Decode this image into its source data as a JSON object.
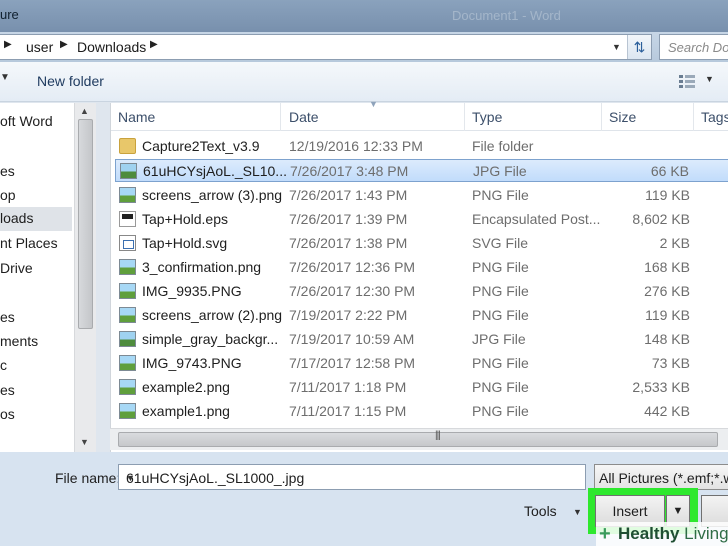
{
  "window": {
    "title_fragment": "ure",
    "document_title": "Document1 - Word"
  },
  "address": {
    "crumbs": [
      "user",
      "Downloads"
    ]
  },
  "search": {
    "placeholder": "Search Do"
  },
  "toolbar": {
    "new_folder_label": "New folder"
  },
  "nav": {
    "items": [
      "oft Word",
      "es",
      "op",
      "loads",
      "nt Places",
      "Drive",
      "es",
      "ments",
      "c",
      "es",
      "os"
    ],
    "selected_index": 3
  },
  "columns": {
    "name": "Name",
    "date": "Date",
    "type": "Type",
    "size": "Size",
    "tags": "Tags"
  },
  "files": [
    {
      "name": "Capture2Text_v3.9",
      "date": "12/19/2016 12:33 PM",
      "type": "File folder",
      "size": "",
      "icon": "folder-icon"
    },
    {
      "name": "61uHCYsjAoL._SL10...",
      "date": "7/26/2017 3:48 PM",
      "type": "JPG File",
      "size": "66 KB",
      "icon": "jpg-file-icon"
    },
    {
      "name": "screens_arrow (3).png",
      "date": "7/26/2017 1:43 PM",
      "type": "PNG File",
      "size": "119 KB",
      "icon": "png-file-icon"
    },
    {
      "name": "Tap+Hold.eps",
      "date": "7/26/2017 1:39 PM",
      "type": "Encapsulated Post...",
      "size": "8,602 KB",
      "icon": "eps-file-icon"
    },
    {
      "name": "Tap+Hold.svg",
      "date": "7/26/2017 1:38 PM",
      "type": "SVG File",
      "size": "2 KB",
      "icon": "svg-file-icon"
    },
    {
      "name": "3_confirmation.png",
      "date": "7/26/2017 12:36 PM",
      "type": "PNG File",
      "size": "168 KB",
      "icon": "png-file-icon"
    },
    {
      "name": "IMG_9935.PNG",
      "date": "7/26/2017 12:30 PM",
      "type": "PNG File",
      "size": "276 KB",
      "icon": "png-file-icon"
    },
    {
      "name": "screens_arrow (2).png",
      "date": "7/19/2017 2:22 PM",
      "type": "PNG File",
      "size": "119 KB",
      "icon": "png-file-icon"
    },
    {
      "name": "simple_gray_backgr...",
      "date": "7/19/2017 10:59 AM",
      "type": "JPG File",
      "size": "148 KB",
      "icon": "jpg-file-icon"
    },
    {
      "name": "IMG_9743.PNG",
      "date": "7/17/2017 12:58 PM",
      "type": "PNG File",
      "size": "73 KB",
      "icon": "png-file-icon"
    },
    {
      "name": "example2.png",
      "date": "7/11/2017 1:18 PM",
      "type": "PNG File",
      "size": "2,533 KB",
      "icon": "png-file-icon"
    },
    {
      "name": "example1.png",
      "date": "7/11/2017 1:15 PM",
      "type": "PNG File",
      "size": "442 KB",
      "icon": "png-file-icon"
    }
  ],
  "selected_file_index": 1,
  "footer": {
    "file_name_label": "File name:",
    "file_name_value": "61uHCYsjAoL._SL1000_.jpg",
    "filter_value": "All Pictures (*.emf;*.w",
    "tools_label": "Tools",
    "insert_label": "Insert"
  },
  "watermark": {
    "brand_prefix": "Healthy",
    "brand_suffix": "Living"
  },
  "colors": {
    "highlight": "#2ee82e",
    "selection": "#c1dcfb"
  }
}
